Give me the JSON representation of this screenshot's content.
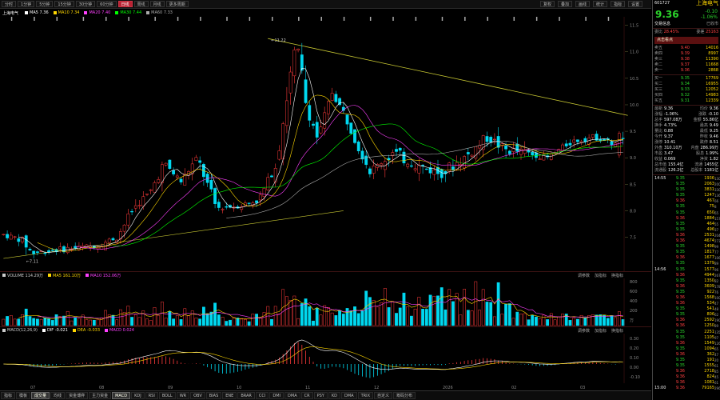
{
  "toolbar": {
    "tabs": [
      {
        "label": "分时",
        "active": false
      },
      {
        "label": "1分钟",
        "active": false
      },
      {
        "label": "5分钟",
        "active": false
      },
      {
        "label": "15分钟",
        "active": false
      },
      {
        "label": "30分钟",
        "active": false
      },
      {
        "label": "60分钟",
        "active": false
      },
      {
        "label": "日线",
        "active": true
      },
      {
        "label": "周线",
        "active": false
      },
      {
        "label": "月线",
        "active": false
      },
      {
        "label": "更多周期",
        "active": false
      }
    ],
    "right_buttons": [
      "复权",
      "叠加",
      "画线",
      "统计",
      "指标",
      "设置"
    ]
  },
  "main_panel": {
    "title": "上海电气",
    "indicators": [
      {
        "label": "MA5 7.36",
        "color": "#ffffff"
      },
      {
        "label": "MA10 7.34",
        "color": "#ffd700"
      },
      {
        "label": "MA20 7.40",
        "color": "#ff40ff"
      },
      {
        "label": "MA30 7.44",
        "color": "#00ff00"
      },
      {
        "label": "MA60 7.33",
        "color": "#aaaaaa"
      }
    ],
    "high_label": "11.22",
    "low_label": "7.11",
    "price_ticks": [
      "11.5",
      "11.0",
      "10.5",
      "10.0",
      "9.5",
      "9.0",
      "8.5",
      "8.0",
      "7.5"
    ],
    "month_ticks": [
      "07",
      "08",
      "09",
      "10",
      "11",
      "12",
      "2026",
      "02",
      "03"
    ]
  },
  "volume_panel": {
    "indicators": [
      {
        "label": "VOLUME 114.29万",
        "color": "#cccccc"
      },
      {
        "label": "MA5 161.10万",
        "color": "#ffd700"
      },
      {
        "label": "MA10 152.06万",
        "color": "#ff40ff"
      }
    ],
    "buttons": [
      "调参数",
      "加指标",
      "换指标"
    ],
    "ticks": [
      "800",
      "600",
      "400",
      "200",
      "万"
    ]
  },
  "macd_panel": {
    "indicators": [
      {
        "label": "MACD(12,26,9)",
        "color": "#cccccc"
      },
      {
        "label": "DIF -0.021",
        "color": "#ffffff"
      },
      {
        "label": "DEA -0.033",
        "color": "#ffd700"
      },
      {
        "label": "MACD 0.024",
        "color": "#ff40ff"
      }
    ],
    "buttons": [
      "调参数",
      "加指标",
      "换指标"
    ],
    "ticks": [
      "0.30",
      "0.20",
      "0.10",
      "0.00",
      "-0.10"
    ]
  },
  "bottom_tabs": [
    {
      "label": "指标",
      "active": false
    },
    {
      "label": "模板",
      "active": false
    },
    {
      "label": "成交量",
      "active": true
    },
    {
      "label": "均线",
      "active": false
    },
    {
      "label": "资金博弈",
      "active": false
    },
    {
      "label": "主力资金",
      "active": false
    },
    {
      "label": "MACD",
      "active": true
    },
    {
      "label": "KDJ",
      "active": false
    },
    {
      "label": "RSI",
      "active": false
    },
    {
      "label": "BOLL",
      "active": false
    },
    {
      "label": "WR",
      "active": false
    },
    {
      "label": "OBV",
      "active": false
    },
    {
      "label": "BIAS",
      "active": false
    },
    {
      "label": "ENE",
      "active": false
    },
    {
      "label": "BRAR",
      "active": false
    },
    {
      "label": "CCI",
      "active": false
    },
    {
      "label": "DMI",
      "active": false
    },
    {
      "label": "DMA",
      "active": false
    },
    {
      "label": "CR",
      "active": false
    },
    {
      "label": "PSY",
      "active": false
    },
    {
      "label": "KD",
      "active": false
    },
    {
      "label": "DMA",
      "active": false
    },
    {
      "label": "TRIX",
      "active": false
    },
    {
      "label": "自定义",
      "active": false
    },
    {
      "label": "筹码分布",
      "active": false
    }
  ],
  "quote": {
    "code": "601727",
    "name": "上海电气",
    "price": "9.36",
    "change": "-0.10",
    "pct": "-1.06%",
    "status": "已收市",
    "tab_label": "交易信息",
    "weibi_label": "委比",
    "weibi": "28.45%",
    "weicha_label": "委差",
    "weicha": "25163",
    "promo": "点击看点",
    "sell": [
      {
        "label": "卖五",
        "price": "9.40",
        "vol": "14016"
      },
      {
        "label": "卖四",
        "price": "9.39",
        "vol": "8997"
      },
      {
        "label": "卖三",
        "price": "9.38",
        "vol": "11390"
      },
      {
        "label": "卖二",
        "price": "9.37",
        "vol": "11668"
      },
      {
        "label": "卖一",
        "price": "9.36",
        "vol": "2868"
      }
    ],
    "buy": [
      {
        "label": "买一",
        "price": "9.35",
        "vol": "17769"
      },
      {
        "label": "买二",
        "price": "9.34",
        "vol": "16955"
      },
      {
        "label": "买三",
        "price": "9.33",
        "vol": "12052"
      },
      {
        "label": "买四",
        "price": "9.32",
        "vol": "14983"
      },
      {
        "label": "买五",
        "price": "9.31",
        "vol": "12339"
      }
    ],
    "stats": [
      {
        "l1": "最新",
        "v1": "9.36",
        "l2": "均价",
        "v2": "9.36"
      },
      {
        "l1": "涨幅",
        "v1": "-1.06%",
        "l2": "涨跌",
        "v2": "-0.10"
      },
      {
        "l1": "总手",
        "v1": "597.08万",
        "l2": "金额",
        "v2": "55.86亿"
      },
      {
        "l1": "换手",
        "v1": "4.73%",
        "l2": "最高",
        "v2": "9.49"
      },
      {
        "l1": "量比",
        "v1": "0.88",
        "l2": "最低",
        "v2": "9.25"
      },
      {
        "l1": "今开",
        "v1": "9.37",
        "l2": "昨收",
        "v2": "9.46"
      },
      {
        "l1": "涨停",
        "v1": "10.41",
        "l2": "跌停",
        "v2": "8.51"
      },
      {
        "l1": "外盘",
        "v1": "310.10万",
        "l2": "内盘",
        "v2": "286.99万"
      },
      {
        "l1": "市盈",
        "v1": "3.47",
        "l2": "股息",
        "v2": "1.99%"
      },
      {
        "l1": "收益",
        "v1": "0.069",
        "l2": "净资",
        "v2": "1.82"
      },
      {
        "l1": "总市值",
        "v1": "155.4亿",
        "l2": "流通",
        "v2": "1455亿"
      },
      {
        "l1": "流通股",
        "v1": "126.2亿",
        "l2": "总股本",
        "v2": "1181亿"
      }
    ],
    "ticks": [
      {
        "t": "14:55",
        "p": "9.35",
        "v": "1936",
        "n": "130"
      },
      {
        "t": "",
        "p": "9.35",
        "v": "2063",
        "n": "200"
      },
      {
        "t": "",
        "p": "9.35",
        "v": "3831",
        "n": "330"
      },
      {
        "t": "",
        "p": "9.35",
        "v": "1247",
        "n": "136"
      },
      {
        "t": "",
        "p": "9.36",
        "v": "467",
        "n": "66"
      },
      {
        "t": "",
        "p": "9.35",
        "v": "75",
        "n": "8"
      },
      {
        "t": "",
        "p": "9.35",
        "v": "650",
        "n": "65"
      },
      {
        "t": "",
        "p": "9.36",
        "v": "1884",
        "n": "157"
      },
      {
        "t": "",
        "p": "9.35",
        "v": "464",
        "n": "55"
      },
      {
        "t": "",
        "p": "9.35",
        "v": "496",
        "n": "37"
      },
      {
        "t": "",
        "p": "9.36",
        "v": "2531",
        "n": "204"
      },
      {
        "t": "",
        "p": "9.36",
        "v": "4674",
        "n": "273"
      },
      {
        "t": "",
        "p": "9.35",
        "v": "1498",
        "n": "99"
      },
      {
        "t": "",
        "p": "9.35",
        "v": "1817",
        "n": "77"
      },
      {
        "t": "",
        "p": "9.36",
        "v": "1677",
        "n": "106"
      },
      {
        "t": "",
        "p": "9.35",
        "v": "1379",
        "n": "89"
      },
      {
        "t": "14:56",
        "p": "9.35",
        "v": "1577",
        "n": "96"
      },
      {
        "t": "",
        "p": "9.36",
        "v": "4944",
        "n": "267"
      },
      {
        "t": "",
        "p": "9.35",
        "v": "1350",
        "n": "82"
      },
      {
        "t": "",
        "p": "9.36",
        "v": "3609",
        "n": "178"
      },
      {
        "t": "",
        "p": "9.35",
        "v": "922",
        "n": "76"
      },
      {
        "t": "",
        "p": "9.36",
        "v": "1568",
        "n": "100"
      },
      {
        "t": "",
        "p": "9.36",
        "v": "534",
        "n": "47"
      },
      {
        "t": "",
        "p": "9.35",
        "v": "541",
        "n": "48"
      },
      {
        "t": "",
        "p": "9.35",
        "v": "806",
        "n": "62"
      },
      {
        "t": "",
        "p": "9.36",
        "v": "2592",
        "n": "190"
      },
      {
        "t": "",
        "p": "9.36",
        "v": "1250",
        "n": "89"
      },
      {
        "t": "",
        "p": "9.35",
        "v": "2251",
        "n": "135"
      },
      {
        "t": "",
        "p": "9.35",
        "v": "1105",
        "n": "97"
      },
      {
        "t": "",
        "p": "9.36",
        "v": "1549",
        "n": "126"
      },
      {
        "t": "",
        "p": "9.35",
        "v": "1094",
        "n": "65"
      },
      {
        "t": "",
        "p": "9.36",
        "v": "362",
        "n": "47"
      },
      {
        "t": "",
        "p": "9.35",
        "v": "191",
        "n": "20"
      },
      {
        "t": "",
        "p": "9.35",
        "v": "1555",
        "n": "61"
      },
      {
        "t": "",
        "p": "9.36",
        "v": "2718",
        "n": "85"
      },
      {
        "t": "",
        "p": "9.36",
        "v": "824",
        "n": "45"
      },
      {
        "t": "",
        "p": "9.36",
        "v": "1081",
        "n": "61"
      },
      {
        "t": "15:00",
        "p": "9.36",
        "v": "79165",
        "n": "2967"
      }
    ]
  },
  "chart_data": {
    "type": "candlestick",
    "title": "上海电气",
    "price_range": [
      7.0,
      11.6
    ],
    "grid": false,
    "description_level": "approximate daily candles (Jul 2025 - Mar 2026) with MA lines, volume and MACD"
  }
}
